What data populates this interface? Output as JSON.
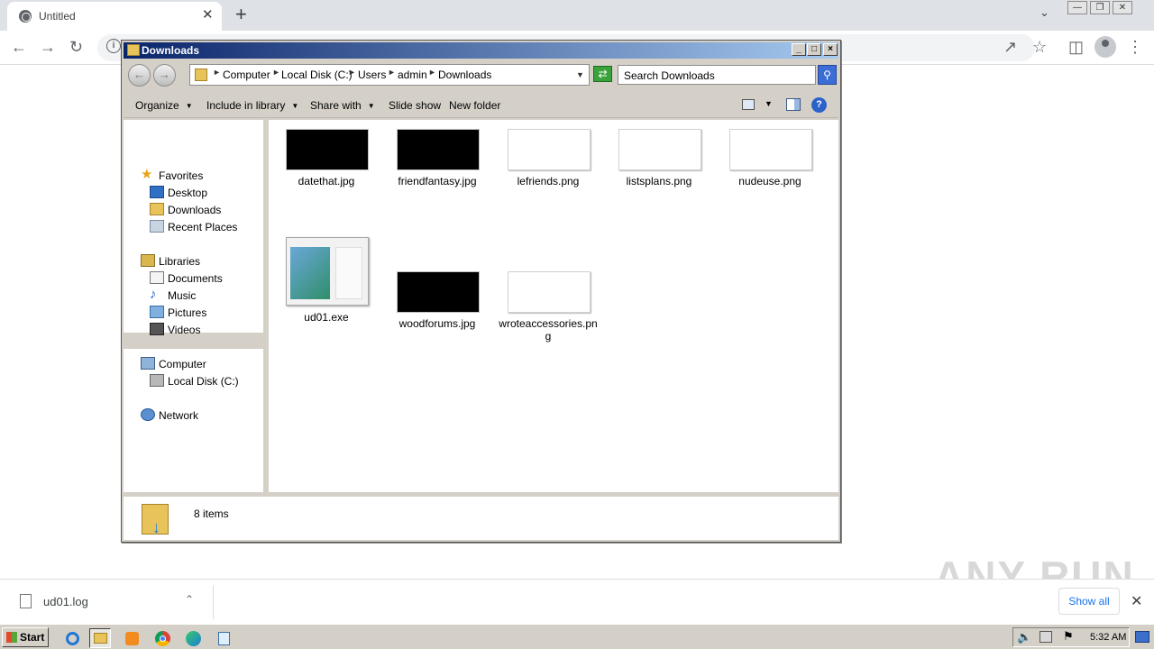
{
  "browser": {
    "tab_title": "Untitled",
    "tab_close": "✕",
    "new_tab": "+"
  },
  "explorer": {
    "window_title": "Downloads",
    "breadcrumbs": [
      "Computer",
      "Local Disk (C:)",
      "Users",
      "admin",
      "Downloads"
    ],
    "search_placeholder": "Search Downloads",
    "commands": {
      "organize": "Organize",
      "include_in_library": "Include in library",
      "share_with": "Share with",
      "slide_show": "Slide show",
      "new_folder": "New folder"
    },
    "nav": {
      "favorites": "Favorites",
      "desktop": "Desktop",
      "downloads": "Downloads",
      "recent_places": "Recent Places",
      "libraries": "Libraries",
      "documents": "Documents",
      "music": "Music",
      "pictures": "Pictures",
      "videos": "Videos",
      "computer": "Computer",
      "local_disk": "Local Disk (C:)",
      "network": "Network"
    },
    "files": [
      {
        "name": "datethat.jpg",
        "thumb": "black"
      },
      {
        "name": "friendfantasy.jpg",
        "thumb": "black"
      },
      {
        "name": "lefriends.png",
        "thumb": "white"
      },
      {
        "name": "listsplans.png",
        "thumb": "white"
      },
      {
        "name": "nudeuse.png",
        "thumb": "white"
      },
      {
        "name": "ud01.exe",
        "thumb": "installer"
      },
      {
        "name": "woodforums.jpg",
        "thumb": "black"
      },
      {
        "name": "wroteaccessories.png",
        "thumb": "white"
      }
    ],
    "status": "8 items"
  },
  "download_shelf": {
    "file_name": "ud01.log",
    "show_all": "Show all",
    "close": "✕"
  },
  "watermark": "ANY RUN",
  "taskbar": {
    "start": "Start",
    "clock": "5:32 AM"
  }
}
